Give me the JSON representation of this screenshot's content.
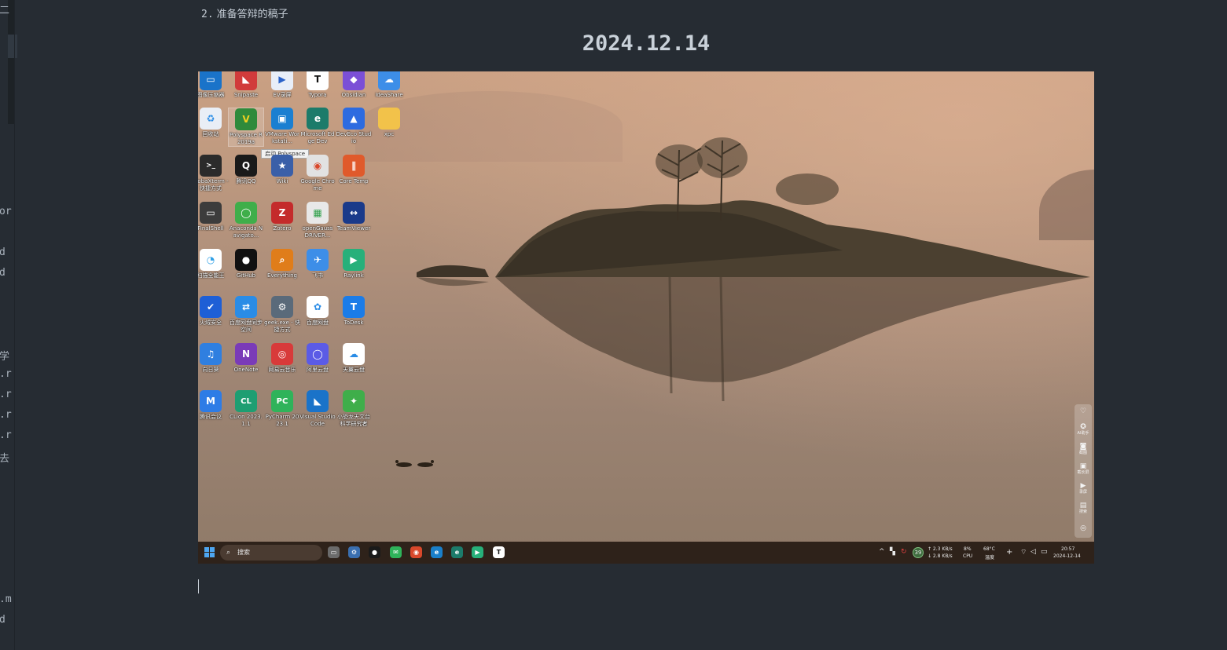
{
  "editor": {
    "list_number": "2.",
    "list_text": "准备答辩的稿子",
    "heading": "2024.12.14",
    "left_fragments": [
      "二",
      "or",
      "d",
      "d",
      "学",
      ".r",
      ".r",
      ".r",
      ".r",
      "去",
      ".m",
      "d"
    ]
  },
  "desktop": {
    "icons": [
      {
        "label": "图像压缩器",
        "color": "#1a73c9",
        "glyph": "▭"
      },
      {
        "label": "Snipaste",
        "color": "#d13b3b",
        "glyph": "◣"
      },
      {
        "label": "EV录屏",
        "color": "#e8eef8",
        "glyph": "▶"
      },
      {
        "label": "Typora",
        "color": "#ffffff",
        "glyph": "T"
      },
      {
        "label": "Obsidian",
        "color": "#7b4fd6",
        "glyph": "◆"
      },
      {
        "label": "IdeaShare",
        "color": "#3d8ee8",
        "glyph": "☁"
      },
      {
        "label": "回收站",
        "color": "#e9eef6",
        "glyph": "♻"
      },
      {
        "label": "Polyspace R2019a",
        "color": "#2f8a3b",
        "glyph": "V"
      },
      {
        "label": "VMware Workstati...",
        "color": "#1b7fd1",
        "glyph": "▣"
      },
      {
        "label": "Microsoft Edge Dev",
        "color": "#1c7b6a",
        "glyph": "e"
      },
      {
        "label": "DevEco Studio",
        "color": "#2d6be0",
        "glyph": "▲"
      },
      {
        "label": "xpc",
        "color": "#f2c24a",
        "glyph": "▬"
      },
      {
        "label": "MobaXterm - 快捷方式",
        "color": "#2b2b2b",
        "glyph": ">_"
      },
      {
        "label": "腾讯QQ",
        "color": "#1a1a1a",
        "glyph": "Q"
      },
      {
        "label": "Wiki",
        "color": "#3a5fa8",
        "glyph": "★"
      },
      {
        "label": "Google Chrome",
        "color": "#e2e2e2",
        "glyph": "◉"
      },
      {
        "label": "Core Temp",
        "color": "#e05a2b",
        "glyph": "∥"
      },
      {
        "label": "FinalShell",
        "color": "#3c3c3c",
        "glyph": "▭"
      },
      {
        "label": "Anaconda Navigato...",
        "color": "#3fae4a",
        "glyph": "◯"
      },
      {
        "label": "Zotero",
        "color": "#c42b2b",
        "glyph": "Z"
      },
      {
        "label": "openGauss DRIVER...",
        "color": "#e8e8e8",
        "glyph": "▦"
      },
      {
        "label": "TeamViewer",
        "color": "#1a3a8a",
        "glyph": "↔"
      },
      {
        "label": "扫描全能王",
        "color": "#2fa0e6",
        "glyph": "◔"
      },
      {
        "label": "GitHub",
        "color": "#111111",
        "glyph": "●"
      },
      {
        "label": "Everything",
        "color": "#e07d1a",
        "glyph": "⌕"
      },
      {
        "label": "飞书",
        "color": "#3d8ee8",
        "glyph": "✈"
      },
      {
        "label": "Raylink",
        "color": "#27b07a",
        "glyph": "▶"
      },
      {
        "label": "火绒安全",
        "color": "#1e5fd6",
        "glyph": "✔"
      },
      {
        "label": "百度网盘同步空间",
        "color": "#2a8ce6",
        "glyph": "⇄"
      },
      {
        "label": "geek.exe - 快捷方式",
        "color": "#5a6a7a",
        "glyph": "⚙"
      },
      {
        "label": "百度网盘",
        "color": "#ffffff",
        "glyph": "✿"
      },
      {
        "label": "ToDesk",
        "color": "#1b7ce8",
        "glyph": "T"
      },
      {
        "label": "向日葵",
        "color": "#2f7fe0",
        "glyph": "♫"
      },
      {
        "label": "OneNote",
        "color": "#7a3bb8",
        "glyph": "N"
      },
      {
        "label": "网易云音乐",
        "color": "#d83a3a",
        "glyph": "◎"
      },
      {
        "label": "阿里云盘",
        "color": "#5b5be6",
        "glyph": "◯"
      },
      {
        "label": "天翼云盘",
        "color": "#ffffff",
        "glyph": "☁"
      },
      {
        "label": "腾讯会议",
        "color": "#2d7ce6",
        "glyph": "M"
      },
      {
        "label": "CLion 2023.1.1",
        "color": "#1e9e72",
        "glyph": "CL"
      },
      {
        "label": "PyCharm 2023.1",
        "color": "#2fb35a",
        "glyph": "PC"
      },
      {
        "label": "Visual Studio Code",
        "color": "#1a73c9",
        "glyph": "◣"
      },
      {
        "label": "小恐龙天文台 科学研究者",
        "color": "#3fae4a",
        "glyph": "✦"
      }
    ],
    "tooltip": "启动 Polyspace"
  },
  "side_panel": {
    "items": [
      {
        "glyph": "♡",
        "label": ""
      },
      {
        "glyph": "✪",
        "label": "AI助手"
      },
      {
        "glyph": "◙",
        "label": "截图"
      },
      {
        "glyph": "▣",
        "label": "截长屏"
      },
      {
        "glyph": "▶",
        "label": "录屏"
      },
      {
        "glyph": "▤",
        "label": "搜索"
      },
      {
        "glyph": "◎",
        "label": ""
      }
    ]
  },
  "taskbar": {
    "search_placeholder": "搜索",
    "apps": [
      {
        "glyph": "▭",
        "color": "#6b6b6b"
      },
      {
        "glyph": "⚙",
        "color": "#3a6fb0"
      },
      {
        "glyph": "●",
        "color": "#1a1a1a"
      },
      {
        "glyph": "✉",
        "color": "#2fb35a"
      },
      {
        "glyph": "◉",
        "color": "#d9482b"
      },
      {
        "glyph": "e",
        "color": "#1a7fc9"
      },
      {
        "glyph": "e",
        "color": "#1c7b6a"
      },
      {
        "glyph": "▶",
        "color": "#27b07a"
      },
      {
        "glyph": "T",
        "color": "#ffffff"
      }
    ],
    "tray": {
      "caret": "^",
      "badge": "39",
      "net_up": "↑ 2.3 KB/s",
      "net_down": "↓ 2.8 KB/s",
      "cpu_value": "8%",
      "cpu_label": "CPU",
      "temp_value": "68°C",
      "temp_label": "温度",
      "time": "20:57",
      "date": "2024-12-14"
    }
  }
}
